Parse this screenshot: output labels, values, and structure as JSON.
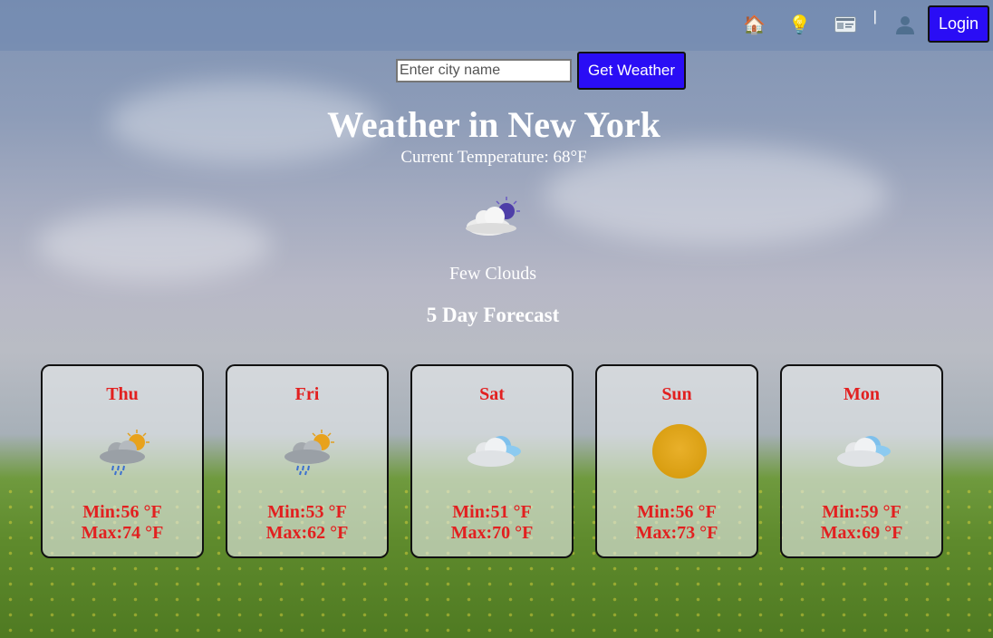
{
  "nav": {
    "icons": [
      "home-icon",
      "lightbulb-icon",
      "id-card-icon",
      "user-icon"
    ],
    "separator": "|",
    "login_label": "Login"
  },
  "search": {
    "placeholder": "Enter city name",
    "value": "",
    "button_label": "Get Weather"
  },
  "weather": {
    "title": "Weather in New York",
    "current_temperature": "Current Temperature: 68°F",
    "icon": "few-clouds-night-icon",
    "description": "Few Clouds"
  },
  "forecast": {
    "title": "5 Day Forecast",
    "days": [
      {
        "day": "Thu",
        "icon": "sun-rain-cloud-icon",
        "min": "Min:56 °F",
        "max": "Max:74 °F"
      },
      {
        "day": "Fri",
        "icon": "sun-rain-cloud-icon",
        "min": "Min:53 °F",
        "max": "Max:62 °F"
      },
      {
        "day": "Sat",
        "icon": "cloud-icon",
        "min": "Min:51 °F",
        "max": "Max:70 °F"
      },
      {
        "day": "Sun",
        "icon": "sun-icon",
        "min": "Min:56 °F",
        "max": "Max:73 °F"
      },
      {
        "day": "Mon",
        "icon": "cloud-icon",
        "min": "Min:59 °F",
        "max": "Max:69 °F"
      }
    ]
  },
  "colors": {
    "accent": "#2a0df5",
    "forecast_text": "#e22020"
  }
}
